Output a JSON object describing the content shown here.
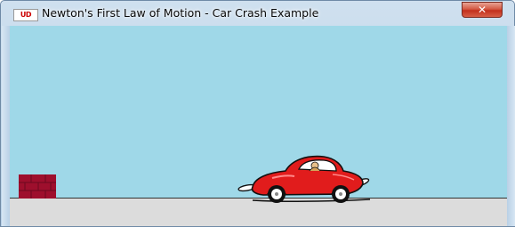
{
  "window": {
    "title": "Newton's First Law of Motion - Car Crash Example",
    "app_icon_text": "UD",
    "close_symbol": "✕"
  },
  "scene": {
    "sky_color": "#9fd8e8",
    "ground_color": "#dcdcdc",
    "wall_color": "#9e0f2d",
    "car_color": "#e11c1c"
  }
}
